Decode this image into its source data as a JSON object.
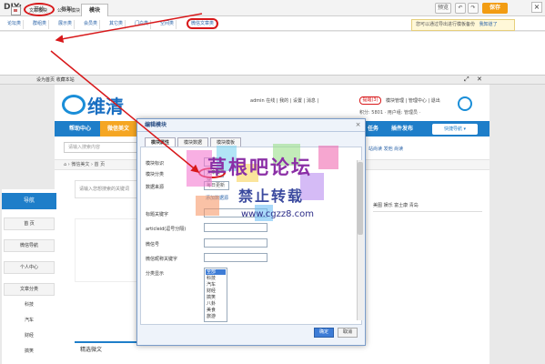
{
  "toolbar": {
    "diy_label": "DIY:",
    "tabs": [
      "开始",
      "框架",
      "模块"
    ],
    "btn_preview": "预览",
    "btn_undo": "↶",
    "btn_redo": "↷",
    "btn_save": "保存",
    "btn_close": "×"
  },
  "categories": [
    "论坛类",
    "群组类",
    "展示类",
    "会员类",
    "其它类",
    "门户类",
    "空间类",
    "微信文章类"
  ],
  "tip": "您可以通过导出进行模板备份",
  "tip_link": "我知道了",
  "modules": {
    "item1": "文章模块",
    "item2": "公众号模块"
  },
  "strip": "设为首页   收藏本站",
  "site": {
    "logo_text": "维清",
    "user_bar": "admin 在线 | 我的 | 设置 | 消息 |",
    "hd_label": "提醒(3)",
    "right_links": "模块管理 | 管理中心 | 退出",
    "points": "积分: 5801 ·  用户组: 管理员 ·",
    "nav": [
      "帮助中心",
      "微信美文",
      "任务",
      "插件发布"
    ],
    "quick_nav": "快捷导航 ▾",
    "search_placeholder": "请输入搜索内容",
    "sub_links": "站尚读 发他 尚读",
    "breadcrumb": "⌂  ›  微信美文  ›  首 页",
    "content_hint": "请输入您想搜索的关键词",
    "tags": "美图   娱乐   富士康   青岛",
    "featured": "精选微文"
  },
  "sidebar": {
    "head": "导航",
    "buttons": [
      "首 页",
      "微信导航",
      "个人中心",
      "文章分类"
    ],
    "subs": [
      "科技",
      "汽车",
      "财经",
      "搞笑"
    ]
  },
  "dialog": {
    "title": "编辑模块",
    "close": "×",
    "tabs": [
      "模块属性",
      "模块数据",
      "模块模板"
    ],
    "labels": [
      "模块标识",
      "模块分类",
      "数据来源",
      "标题关键字",
      "articleid(逗号分隔)",
      "微信号",
      "微信昵称关键字",
      "分类显示"
    ],
    "fields": [
      "",
      "文章模块",
      "每日更新",
      "",
      "",
      "",
      "",
      ""
    ],
    "source_link": "添加数据源",
    "class_options": [
      "全部",
      "科技",
      "汽车",
      "财经",
      "搞笑",
      "八卦",
      "美食",
      "旅游"
    ],
    "ok": "确定",
    "cancel": "取消"
  },
  "watermark": {
    "title": "草根吧论坛",
    "sub": "禁止转载",
    "url": "www.cgzz8.com"
  }
}
